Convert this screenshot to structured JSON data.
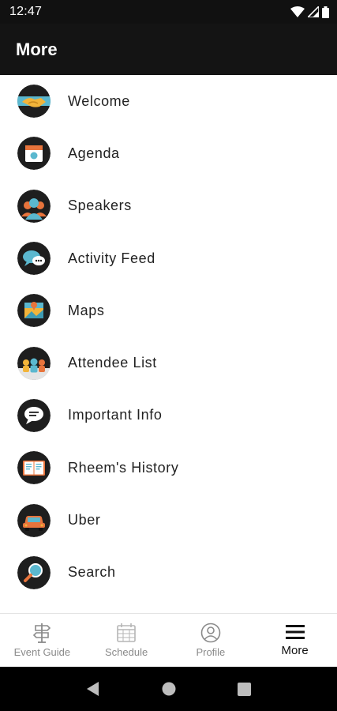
{
  "status_bar": {
    "time": "12:47",
    "icons": [
      "wifi-icon",
      "signal-icon",
      "battery-icon"
    ]
  },
  "header": {
    "title": "More"
  },
  "menu": {
    "items": [
      {
        "label": "Welcome",
        "icon": "handshake-icon"
      },
      {
        "label": "Agenda",
        "icon": "calendar-icon"
      },
      {
        "label": "Speakers",
        "icon": "speakers-icon"
      },
      {
        "label": "Activity Feed",
        "icon": "chat-bubbles-icon"
      },
      {
        "label": "Maps",
        "icon": "map-icon"
      },
      {
        "label": "Attendee List",
        "icon": "attendees-icon"
      },
      {
        "label": "Important Info",
        "icon": "info-bubble-icon"
      },
      {
        "label": "Rheem's History",
        "icon": "book-icon"
      },
      {
        "label": "Uber",
        "icon": "car-icon"
      },
      {
        "label": "Search",
        "icon": "magnifier-icon"
      }
    ]
  },
  "tab_bar": {
    "tabs": [
      {
        "label": "Event Guide",
        "icon": "signpost-icon",
        "active": false
      },
      {
        "label": "Schedule",
        "icon": "calendar-grid-icon",
        "active": false
      },
      {
        "label": "Profile",
        "icon": "profile-icon",
        "active": false
      },
      {
        "label": "More",
        "icon": "hamburger-icon",
        "active": true
      }
    ]
  },
  "colors": {
    "header_bg": "#141414",
    "icon_dark": "#1e1e1e",
    "accent_teal": "#5bb8cf",
    "accent_orange": "#e8743c",
    "accent_yellow": "#f2b43a"
  }
}
